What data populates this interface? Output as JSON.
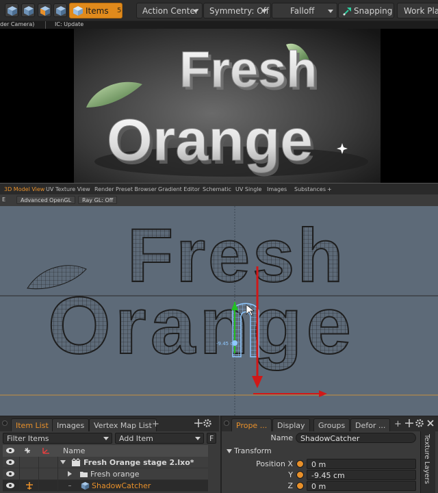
{
  "toolbar": {
    "items_label": "Items",
    "items_shortcut": "5",
    "action_center": "Action Center",
    "symmetry": "Symmetry: Off",
    "falloff": "Falloff",
    "snapping": "Snapping",
    "work_plane": "Work Plane"
  },
  "render": {
    "tab_left": "der Camera)",
    "tab_ic": "IC: Update",
    "title_line1": "Fresh",
    "title_line2": "Orange"
  },
  "viewport_tabs": [
    "3D Model View",
    "UV Texture View",
    "Render Preset Browser",
    "Gradient Editor",
    "Schematic",
    "UV Single",
    "Images",
    "Substances"
  ],
  "viewport_tabs_plus": "+",
  "viewport_options": {
    "e_label": "E",
    "shading": "Advanced OpenGL",
    "raygl": "Ray GL: Off"
  },
  "viewport": {
    "word1": "Fresh",
    "word2": "Orange",
    "measure": "-9.45 cm",
    "colors": {
      "background": "#5d6a78",
      "wire": "#1e1e1e",
      "selected": "#8fc8ff",
      "y_axis_arrow": "#d01818",
      "x_axis_arrow": "#d01818",
      "green_axis": "#22c022"
    }
  },
  "item_list": {
    "tabs": [
      "Item List",
      "Images",
      "Vertex Map List"
    ],
    "plus": "+",
    "filter": "Filter Items",
    "add_item": "Add Item",
    "f_btn": "F",
    "header_name": "Name",
    "rows": [
      {
        "name": "Fresh Orange stage 2.lxo*",
        "type": "scene"
      },
      {
        "name": "Fresh orange",
        "type": "group"
      },
      {
        "name": "ShadowCatcher",
        "type": "mesh"
      }
    ]
  },
  "properties": {
    "tabs": [
      "Prope ...",
      "Display",
      "Groups",
      "Defor ..."
    ],
    "plus": "+",
    "name_label": "Name",
    "name_value": "ShadowCatcher",
    "section": "Transform",
    "position_label": "Position X",
    "y_label": "Y",
    "z_label": "Z",
    "x_value": "0 m",
    "y_value": "-9.45 cm",
    "z_value": "0 m",
    "side_tab": "Texture Layers"
  },
  "accent_color": "#e8902a"
}
